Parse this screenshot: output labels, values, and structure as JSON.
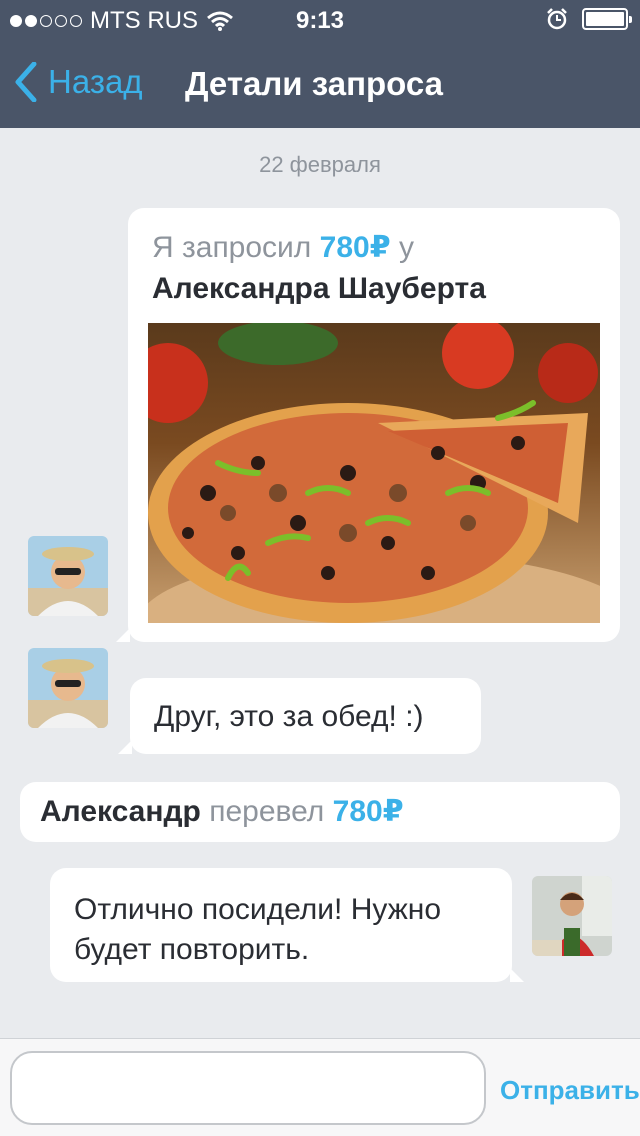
{
  "status_bar": {
    "carrier": "MTS RUS",
    "time": "9:13",
    "signal_bars_filled": 2,
    "signal_bars_total": 5,
    "battery_level": 1.0
  },
  "nav": {
    "back_label": "Назад",
    "title": "Детали запроса"
  },
  "date_separator": "22 февраля",
  "request": {
    "prefix": "Я запросил",
    "amount": "780",
    "currency": "₽",
    "suffix": "у",
    "person": "Александра Шауберта"
  },
  "message_in": {
    "text": "Друг, это за обед! :)"
  },
  "transfer": {
    "name": "Александр",
    "verb": "перевел",
    "amount": "780",
    "currency": "₽"
  },
  "message_out": {
    "line1": "Отлично посидели! Нужно",
    "line2": "будет повторить."
  },
  "composer": {
    "input_value": "",
    "input_placeholder": "",
    "send_label": "Отправить"
  },
  "colors": {
    "accent": "#3bb1e8",
    "bar": "#4a5568",
    "background": "#e9ebee"
  }
}
